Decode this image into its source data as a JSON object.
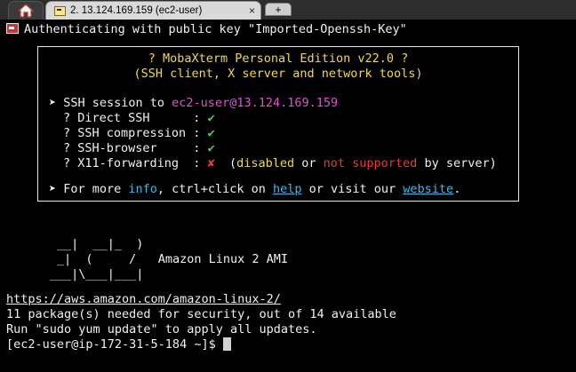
{
  "tabs": {
    "home_icon": "home-icon",
    "active_title": "2. 13.124.169.159 (ec2-user)",
    "close_glyph": "×",
    "new_tab_glyph": "+"
  },
  "terminal": {
    "auth_line": "Authenticating with public key \"Imported-Openssh-Key\"",
    "banner": {
      "title": "? MobaXterm Personal Edition v22.0 ?",
      "subtitle": "(SSH client, X server and network tools)",
      "session_prefix": "➤ SSH session to ",
      "session_target": "ec2-user@13.124.169.159",
      "features": [
        {
          "label": "? Direct SSH      : ",
          "status": "✔",
          "ok": true
        },
        {
          "label": "? SSH compression : ",
          "status": "✔",
          "ok": true
        },
        {
          "label": "? SSH-browser     : ",
          "status": "✔",
          "ok": true
        },
        {
          "label": "? X11-forwarding  : ",
          "status": "✘",
          "ok": false
        }
      ],
      "x11_note_open": "  (",
      "x11_disabled": "disabled",
      "x11_or": " or ",
      "x11_not_supported": "not supported",
      "x11_by_server": " by server)",
      "more_prefix": "➤ For more ",
      "more_info": "info",
      "more_mid": ", ctrl+click on ",
      "more_help": "help",
      "more_mid2": " or visit our ",
      "more_website": "website",
      "more_end": "."
    },
    "ascii_art": [
      "       __|  __|_  )",
      "       _|  (     /   ",
      "      ___|\\___|___|"
    ],
    "ami_label": "Amazon Linux 2 AMI",
    "url": "https://aws.amazon.com/amazon-linux-2/",
    "security_line": "11 package(s) needed for security, out of 14 available",
    "update_line": "Run \"sudo yum update\" to apply all updates.",
    "prompt": "[ec2-user@ip-172-31-5-184 ~]$ "
  },
  "colors": {
    "background": "#000000",
    "text": "#f0f0f0",
    "yellow": "#f2d84a",
    "magenta": "#e34fd8",
    "green": "#4cd64c",
    "red": "#ea3a3a",
    "link": "#3fb8e8"
  }
}
